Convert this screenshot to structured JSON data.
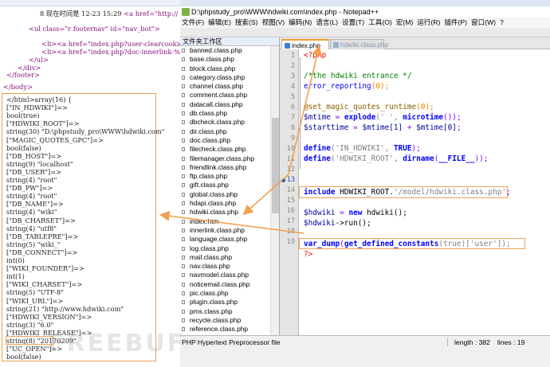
{
  "source": {
    "line1": "8 现在时间是 12-23 15:29 ",
    "line1_tag": "<a href=\"http://",
    "line2_tag": "<ul class=\"r footernav\" id=\"nav_bot\">",
    "line3_tag": "<li><a href=\"index.php?user-clearcookies\"",
    "line4_tag": "<li><a href=\"index.php?doc-innerlink-%E8%8",
    "line5": "</ul>",
    "line6": "</div>",
    "line7": "</footer>",
    "line8": "</body>"
  },
  "dump": {
    "lines": [
      "</html>array(16) {",
      "[\"IN_HDWIKI\"]=>",
      "bool(true)",
      "[\"HDWIKI_ROOT\"]=>",
      "string(30) \"D:\\phpstudy_pro\\WWW\\hdwiki.com\"",
      "[\"MAGIC_QUOTES_GPC\"]=>",
      "bool(false)",
      "[\"DB_HOST\"]=>",
      "string(9) \"localhost\"",
      "[\"DB_USER\"]=>",
      "string(4) \"root\"",
      "[\"DB_PW\"]=>",
      "string(4) \"root\"",
      "[\"DB_NAME\"]=>",
      "string(4) \"wiki\"",
      "[\"DB_CHARSET\"]=>",
      "string(4) \"utf8\"",
      "[\"DB_TABLEPRE\"]=>",
      "string(5) \"wiki_\"",
      "[\"DB_CONNECT\"]=>",
      "int(0)",
      "[\"WIKI_FOUNDER\"]=>",
      "int(1)",
      "[\"WIKI_CHARSET\"]=>",
      "string(5) \"UTF-8\"",
      "[\"WIKI_URL\"]=>",
      "string(21) \"http://www.hdwiki.com\"",
      "[\"HDWIKI_VERSION\"]=>",
      "string(3) \"6.0\"",
      "[\"HDWIKI_RELEASE\"]=>",
      "string(8) \"20170209\"",
      "[\"UC_OPEN\"]=>",
      "bool(false)"
    ]
  },
  "notepad": {
    "title": "D:\\phpstudy_pro\\WWW\\hdwiki.com\\index.php - Notepad++",
    "menu": [
      "文件(F)",
      "编辑(E)",
      "搜索(S)",
      "视图(V)",
      "编码(N)",
      "语言(L)",
      "设置(T)",
      "工具(O)",
      "宏(M)",
      "运行(R)",
      "插件(P)",
      "窗口(W)",
      "?"
    ],
    "file_panel_title": "文件夹工作区",
    "files": [
      "banned.class.php",
      "base.class.php",
      "block.class.php",
      "category.class.php",
      "channel.class.php",
      "comment.class.php",
      "datacall.class.php",
      "db.class.php",
      "dbcheck.class.php",
      "dir.class.php",
      "doc.class.php",
      "filecheck.class.php",
      "filemanager.class.php",
      "friendlink.class.php",
      "ftp.class.php",
      "gift.class.php",
      "global.class.php",
      "hdapi.class.php",
      "hdwiki.class.php",
      "index.htm",
      "innerlink.class.php",
      "language.class.php",
      "log.class.php",
      "mail.class.php",
      "nav.class.php",
      "navmodel.class.php",
      "noticemail.class.php",
      "pic.class.php",
      "plugin.class.php",
      "pms.class.php",
      "recycle.class.php",
      "reference.class.php"
    ],
    "tabs": [
      "index.php",
      "hdwiki.class.php"
    ],
    "line_numbers": [
      "1",
      "2",
      "3",
      "4",
      "5",
      "6",
      "7",
      "8",
      "9",
      "10",
      "11",
      "12",
      "13",
      "14",
      "15",
      "16",
      "17",
      "18",
      "19"
    ],
    "code": {
      "l1": "<?php",
      "l3": "/*the hdwiki entrance */",
      "l4a": "error_reporting",
      "l4b": "(0);",
      "l6a": "@set_magic_quotes_runtime",
      "l6b": "(0);",
      "l7a": "$mtime",
      "l7b": " = ",
      "l7c": "explode",
      "l7d": "(' ', ",
      "l7e": "microtime",
      "l7f": "());",
      "l8a": "$starttime",
      "l8b": " = ",
      "l8c": "$mtime[1]",
      "l8d": " + ",
      "l8e": "$mtime[0]",
      "l8f": ";",
      "l10a": "define",
      "l10b": "('IN_HDWIKI', ",
      "l10c": "TRUE",
      "l10d": ");",
      "l11a": "define",
      "l11b": "('HDWIKI_ROOT', ",
      "l11c": "dirname",
      "l11d": "(",
      "l11e": "__FILE__",
      "l11f": "));",
      "l13a": "include",
      "l13b": " HDWIKI_ROOT.",
      "l13c": "'/model/hdwiki.class.php'",
      "l13d": ";",
      "l15a": "$hdwiki",
      "l15b": " = ",
      "l15c": "new",
      "l15d": " hdwiki();",
      "l16a": "$hdwiki",
      "l16b": "->run();",
      "l18a": "var_dump",
      "l18b": "(",
      "l18c": "get_defined_constants",
      "l18d": "(true)['user']);",
      "l19": "?>"
    },
    "status": {
      "type": "PHP Hypertext Preprocessor file",
      "length": "length : 382",
      "lines": "lines : 19"
    }
  },
  "watermark": "FREEBUF",
  "colors": {
    "highlight": "#f0a050",
    "arrow": "#f0a050"
  }
}
